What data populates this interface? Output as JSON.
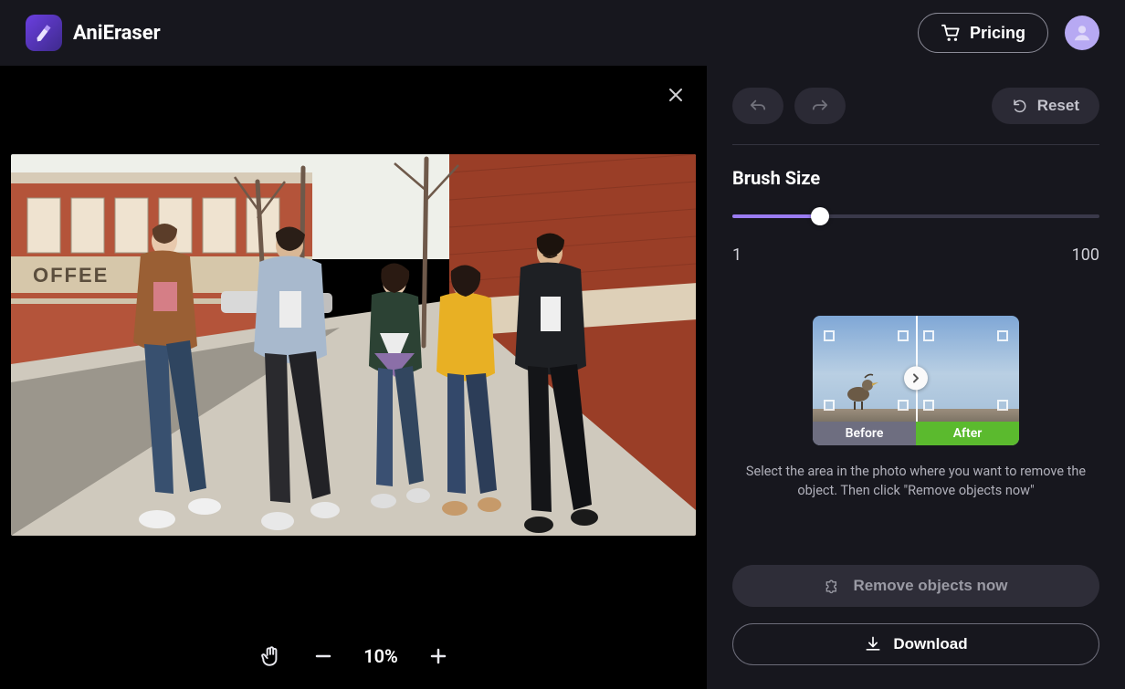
{
  "header": {
    "brand": "AniEraser",
    "pricing_label": "Pricing"
  },
  "canvas": {
    "zoom_label": "10%"
  },
  "sidePanel": {
    "reset_label": "Reset",
    "brush_size_label": "Brush Size",
    "brush_min_label": "1",
    "brush_max_label": "100",
    "brush_value_pct": 24,
    "demo_before_label": "Before",
    "demo_after_label": "After",
    "hint_text": "Select the area in the photo where you want to remove the object. Then click \"Remove objects now\"",
    "remove_label": "Remove objects now",
    "download_label": "Download"
  },
  "chart_data": null
}
